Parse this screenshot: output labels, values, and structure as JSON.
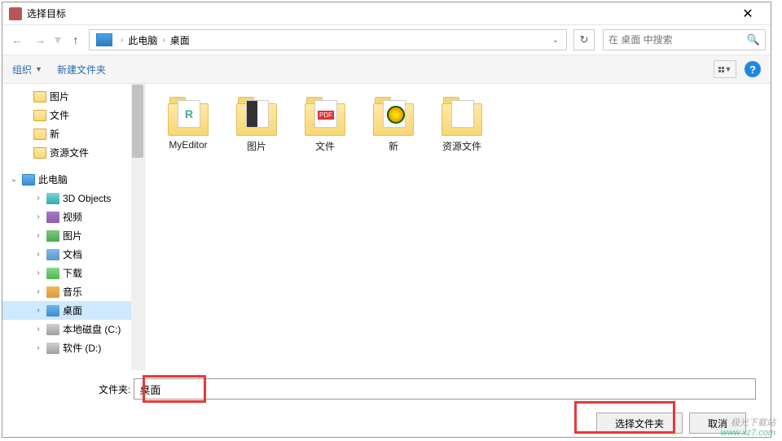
{
  "window": {
    "title": "选择目标"
  },
  "breadcrumb": {
    "root": "此电脑",
    "current": "桌面"
  },
  "search": {
    "placeholder": "在 桌面 中搜索"
  },
  "toolbar": {
    "organize": "组织",
    "new_folder": "新建文件夹"
  },
  "sidebar": {
    "quick": [
      {
        "label": "图片",
        "icon": "folder"
      },
      {
        "label": "文件",
        "icon": "folder"
      },
      {
        "label": "新",
        "icon": "folder"
      },
      {
        "label": "资源文件",
        "icon": "folder"
      }
    ],
    "pc_label": "此电脑",
    "pc_items": [
      {
        "label": "3D Objects",
        "icon": "obj3d"
      },
      {
        "label": "视频",
        "icon": "video"
      },
      {
        "label": "图片",
        "icon": "pic"
      },
      {
        "label": "文档",
        "icon": "doc"
      },
      {
        "label": "下载",
        "icon": "dl"
      },
      {
        "label": "音乐",
        "icon": "music"
      },
      {
        "label": "桌面",
        "icon": "desktop",
        "selected": true
      },
      {
        "label": "本地磁盘 (C:)",
        "icon": "disk"
      },
      {
        "label": "软件 (D:)",
        "icon": "disk"
      }
    ]
  },
  "files": [
    {
      "label": "MyEditor",
      "variant": "green"
    },
    {
      "label": "图片",
      "variant": "dark"
    },
    {
      "label": "文件",
      "variant": "pdf"
    },
    {
      "label": "新",
      "variant": "circ"
    },
    {
      "label": "资源文件",
      "variant": ""
    }
  ],
  "footer": {
    "filename_label": "文件夹:",
    "filename_value": "桌面",
    "select_btn": "选择文件夹",
    "cancel_btn": "取消"
  },
  "watermark": {
    "line1": "极光下载站",
    "line2": "www.xz7.com"
  }
}
